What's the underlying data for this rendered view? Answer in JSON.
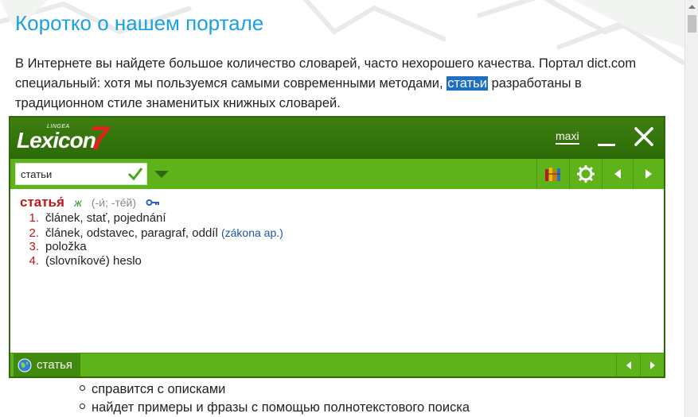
{
  "page": {
    "title": "Коротко о нашем портале",
    "intro_before": "В Интернете вы найдете большое количество словарей, часто нехорошего качества. Портал dict.com специальный: хотя мы пользуемся самыми современными методами, ",
    "intro_highlight": "статьи",
    "intro_after": " разработаны в традиционном стиле знаменитых книжных словарей."
  },
  "lexicon": {
    "logo_small": "LINGEA",
    "logo_word": "Lexicon",
    "logo_number": "7",
    "maxi_label": "maxi",
    "search": {
      "value": "статьи"
    },
    "entry": {
      "headword": "статья́",
      "gender": "ж",
      "forms": "(-и́; -те́й)",
      "senses": [
        {
          "num": "1.",
          "text": "článek, stať, pojednání",
          "note": ""
        },
        {
          "num": "2.",
          "text": "článek, odstavec, paragraf, oddíl",
          "note": "(zákona ap.)"
        },
        {
          "num": "3.",
          "text": "položka",
          "note": ""
        },
        {
          "num": "4.",
          "text": "(slovníkové) heslo",
          "note": ""
        }
      ]
    },
    "status": {
      "label": "статья"
    }
  },
  "bullets": [
    "справится с описками",
    "найдет примеры и фразы с помощью полнотекстового поиска"
  ],
  "colors": {
    "title": "#1ba1e2",
    "header_green": "#2c6a06",
    "toolbar_green": "#5fb31a",
    "headword_red": "#c0161b",
    "highlight_blue": "#1d6fc4"
  }
}
